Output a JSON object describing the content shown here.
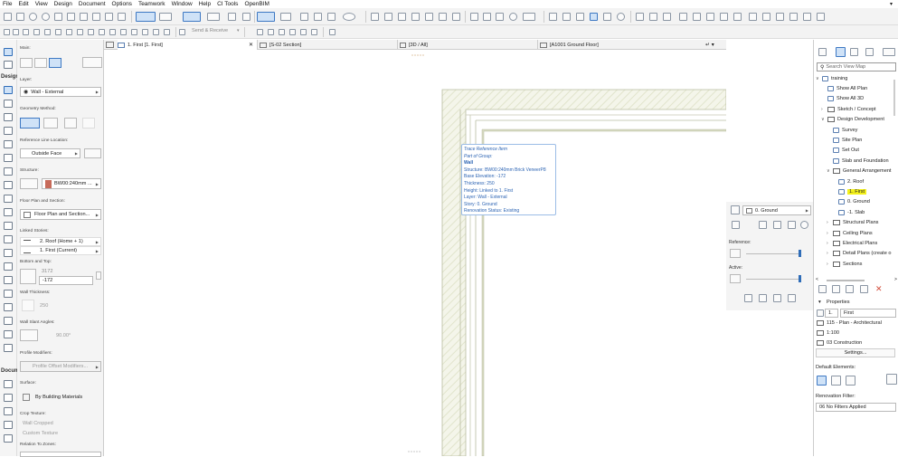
{
  "menu": [
    "File",
    "Edit",
    "View",
    "Design",
    "Document",
    "Options",
    "Teamwork",
    "Window",
    "Help",
    "CI Tools",
    "OpenBIM"
  ],
  "toolbar2": {
    "send_receive": "Send & Receive"
  },
  "toolbox": {
    "groups": {
      "design": "Design",
      "document": "Docum"
    }
  },
  "infobox": {
    "main_label": "Main:",
    "layer_label": "Layer:",
    "layer_value": "Wall - External",
    "geometry_label": "Geometry Method:",
    "refline_label": "Reference Line Location:",
    "refline_value": "Outside Face",
    "structure_label": "Structure:",
    "structure_value": "BW00:240mm ...",
    "floorplan_label": "Floor Plan and Section:",
    "floorplan_value": "Floor Plan and Section...",
    "linked_label": "Linked Stories:",
    "linked_top": "2. Roof (Home + 1)",
    "linked_bottom": "1. First (Current)",
    "bottomtop_label": "Bottom and Top:",
    "top_value": "3172",
    "bottom_value": "-172",
    "thickness_label": "Wall Thickness:",
    "thickness_value": "250",
    "slant_label": "Wall Slant Angles:",
    "slant_value": "90.00°",
    "profile_label": "Profile Modifiers:",
    "profile_value": "Profile Offset Modifiers...",
    "surface_label": "Surface:",
    "surface_value": "By Building Materials",
    "crop_label": "Crop Texture:",
    "wall_cropped": "Wall Cropped",
    "custom_texture": "Custom Texture",
    "relation_label": "Relation To Zones:"
  },
  "tabs": [
    {
      "label": "1. First [1. First]"
    },
    {
      "label": "[S-02 Section]"
    },
    {
      "label": "[3D / All]"
    },
    {
      "label": "[A1001 Ground Floor]"
    }
  ],
  "tooltip": {
    "lines": [
      "Trace Reference Item",
      "Part of Group:",
      "Wall",
      "Structure: BW00:240mm Brick VeneerP8",
      "Base Elevation: -172",
      "Thickness: 250",
      "Height: Linked to 1. First",
      "Layer: Wall - External",
      "Story: 0. Ground",
      "Renovation Status: Existing"
    ]
  },
  "trace": {
    "story": "0. Ground",
    "reference_label": "Reference:",
    "active_label": "Active:"
  },
  "navigator": {
    "search_placeholder": "Search View Map",
    "tree": [
      {
        "label": "training",
        "level": 0,
        "type": "root",
        "chev": "v"
      },
      {
        "label": "Show All Plan",
        "level": 1,
        "type": "view",
        "chev": ""
      },
      {
        "label": "Show All 3D",
        "level": 1,
        "type": "view",
        "chev": ""
      },
      {
        "label": "Sketch / Concept",
        "level": 1,
        "type": "folder",
        "chev": ">"
      },
      {
        "label": "Design Development",
        "level": 1,
        "type": "folder",
        "chev": "v"
      },
      {
        "label": "Survey",
        "level": 2,
        "type": "view",
        "chev": ""
      },
      {
        "label": "Site Plan",
        "level": 2,
        "type": "view",
        "chev": ""
      },
      {
        "label": "Set Out",
        "level": 2,
        "type": "view",
        "chev": ""
      },
      {
        "label": "Slab and Foundation",
        "level": 2,
        "type": "view",
        "chev": ""
      },
      {
        "label": "General Arrangement",
        "level": 2,
        "type": "folder",
        "chev": "v"
      },
      {
        "label": "2. Roof",
        "level": 3,
        "type": "view",
        "chev": ""
      },
      {
        "label": "1. First",
        "level": 3,
        "type": "view",
        "chev": "",
        "selected": true
      },
      {
        "label": "0. Ground",
        "level": 3,
        "type": "view",
        "chev": ""
      },
      {
        "label": "-1. Slab",
        "level": 3,
        "type": "view",
        "chev": ""
      },
      {
        "label": "Structural Plans",
        "level": 2,
        "type": "folder",
        "chev": ">"
      },
      {
        "label": "Ceiling Plans",
        "level": 2,
        "type": "folder",
        "chev": ">"
      },
      {
        "label": "Electrical Plans",
        "level": 2,
        "type": "folder",
        "chev": ">"
      },
      {
        "label": "Detail Plans (create o",
        "level": 2,
        "type": "folder",
        "chev": ">"
      },
      {
        "label": "Sections",
        "level": 2,
        "type": "folder",
        "chev": ">"
      }
    ],
    "properties_header": "Properties",
    "prop_id": "1.",
    "prop_name": "First",
    "prop_mvo": "115 - Plan - Architectural",
    "prop_scale": "1:100",
    "prop_layer": "03 Construction",
    "settings_button": "Settings...",
    "default_elements_label": "Default Elements:",
    "renovation_label": "Renovation Filter:",
    "renovation_value": "06 No Filters Applied"
  },
  "colors": {
    "accent": "#3d78c3",
    "highlight": "#f3f01a",
    "tooltip_text": "#2b63b3",
    "wall_hatch": "#e8ecd8"
  }
}
